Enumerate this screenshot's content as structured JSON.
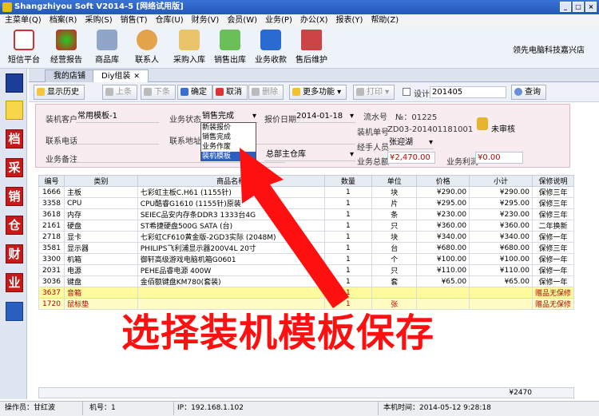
{
  "window": {
    "title": "Shangzhiyou Soft V2014-5 [网络试用版]"
  },
  "menu": [
    "主菜单(Q)",
    "档案(R)",
    "采购(S)",
    "销售(T)",
    "仓库(U)",
    "财务(V)",
    "会员(W)",
    "业务(P)",
    "办公(X)",
    "报表(Y)",
    "帮助(Z)"
  ],
  "toolbar": [
    "短信平台",
    "经营报告",
    "商品库",
    "联系人",
    "采购入库",
    "销售出库",
    "业务收款",
    "售后维护"
  ],
  "brand": "领先电脑科技嘉兴店",
  "sidebar": [
    "",
    "",
    "档",
    "采",
    "销",
    "仓",
    "财",
    "业",
    ""
  ],
  "tabs": [
    "我的店铺",
    "Diy组装"
  ],
  "actions": {
    "history": "显示历史",
    "prev": "上条",
    "next": "下条",
    "confirm": "确定",
    "cancel": "取消",
    "delete": "删除",
    "more": "更多功能",
    "print": "打印",
    "design": "设计",
    "design_value": "201405",
    "query": "查询"
  },
  "form": {
    "customer_label": "装机客户",
    "customer_value": "常用模板-1",
    "status_label": "业务状态",
    "status_value": "销售完成",
    "date_label": "报价日期",
    "date_value": "2014-01-18",
    "flow_label": "流水号",
    "flow_value": "№：01225",
    "phone_label": "联系电话",
    "addr_label": "联系地址",
    "order_label": "装机单号",
    "order_value": "ZD03-201401181001",
    "handler_label": "经手人员",
    "handler_value": "张迎湖",
    "note_label": "业务备注",
    "warehouse_value": "总部主仓库",
    "total_label": "业务总额",
    "total_value": "¥2,470.00",
    "profit_label": "业务利润",
    "profit_value": "¥0.00",
    "audit": "未审核"
  },
  "dropdown": {
    "options": [
      "新装报价",
      "销售完成",
      "业务作废",
      "装机模板"
    ],
    "selected": "装机模板"
  },
  "table": {
    "headers": [
      "编号",
      "类别",
      "商品名称",
      "数量",
      "单位",
      "价格",
      "小计",
      "保修说明"
    ],
    "rows": [
      [
        "1666",
        "主板",
        "七彩虹主板C.H61 (1155针)",
        "1",
        "块",
        "¥290.00",
        "¥290.00",
        "保修三年"
      ],
      [
        "3358",
        "CPU",
        "CPU酷睿G1610 (1155针)原装",
        "1",
        "片",
        "¥295.00",
        "¥295.00",
        "保修三年"
      ],
      [
        "3618",
        "内存",
        "SEIEC品安内存条DDR3 1333台4G",
        "1",
        "条",
        "¥230.00",
        "¥230.00",
        "保修三年"
      ],
      [
        "2161",
        "硬盘",
        "ST希捷硬盘500G SATA (台)",
        "1",
        "只",
        "¥360.00",
        "¥360.00",
        "二年换新"
      ],
      [
        "2718",
        "显卡",
        "七彩虹CF610黄金版-2GD3实际 (2048M)",
        "1",
        "块",
        "¥340.00",
        "¥340.00",
        "保修一年"
      ],
      [
        "3581",
        "显示器",
        "PHILIPS飞利浦显示器200V4L 20寸",
        "1",
        "台",
        "¥680.00",
        "¥680.00",
        "保修三年"
      ],
      [
        "3300",
        "机箱",
        "御轩高级游戏电脑机箱G0601",
        "1",
        "个",
        "¥100.00",
        "¥100.00",
        "保修一年"
      ],
      [
        "2031",
        "电源",
        "PEHE品睿电源 400W",
        "1",
        "只",
        "¥110.00",
        "¥110.00",
        "保修一年"
      ],
      [
        "3036",
        "键盘",
        "金佰额键盘KM780(套装)",
        "1",
        "套",
        "¥65.00",
        "¥65.00",
        "保修一年"
      ],
      [
        "3637",
        "音箱",
        "",
        "1",
        "",
        "",
        "",
        "赠品无保修"
      ],
      [
        "1720",
        "鼠标垫",
        "",
        "1",
        "张",
        "",
        "",
        "赠品无保修"
      ]
    ],
    "sum": "¥2470"
  },
  "status": {
    "operator": "操作员：甘红波",
    "machine": "机号：1",
    "ip": "IP：192.168.1.102",
    "time": "本机时间：2014-05-12 9:28:18"
  },
  "overlay": "选择装机模板保存"
}
